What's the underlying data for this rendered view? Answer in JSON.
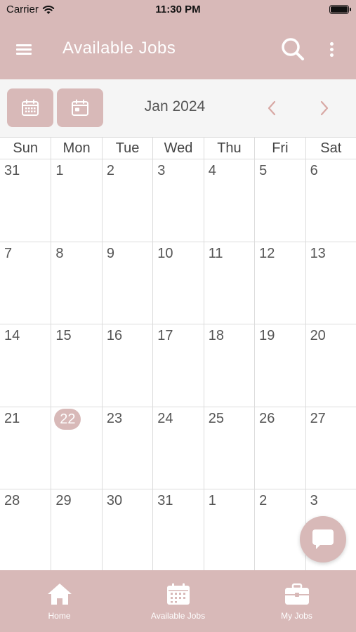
{
  "status_bar": {
    "carrier": "Carrier",
    "time": "11:30 PM"
  },
  "app_bar": {
    "title": "Available Jobs"
  },
  "calendar_header": {
    "month_label": "Jan 2024"
  },
  "calendar": {
    "weekdays": [
      "Sun",
      "Mon",
      "Tue",
      "Wed",
      "Thu",
      "Fri",
      "Sat"
    ],
    "today": "22",
    "weeks": [
      [
        "31",
        "1",
        "2",
        "3",
        "4",
        "5",
        "6"
      ],
      [
        "7",
        "8",
        "9",
        "10",
        "11",
        "12",
        "13"
      ],
      [
        "14",
        "15",
        "16",
        "17",
        "18",
        "19",
        "20"
      ],
      [
        "21",
        "22",
        "23",
        "24",
        "25",
        "26",
        "27"
      ],
      [
        "28",
        "29",
        "30",
        "31",
        "1",
        "2",
        "3"
      ]
    ]
  },
  "tabs": [
    {
      "label": "Home",
      "icon": "home-icon"
    },
    {
      "label": "Available Jobs",
      "icon": "calendar-icon"
    },
    {
      "label": "My Jobs",
      "icon": "briefcase-icon"
    }
  ],
  "colors": {
    "accent": "#d8b9b8",
    "arrow": "#d8a8a4",
    "text": "#555555"
  }
}
